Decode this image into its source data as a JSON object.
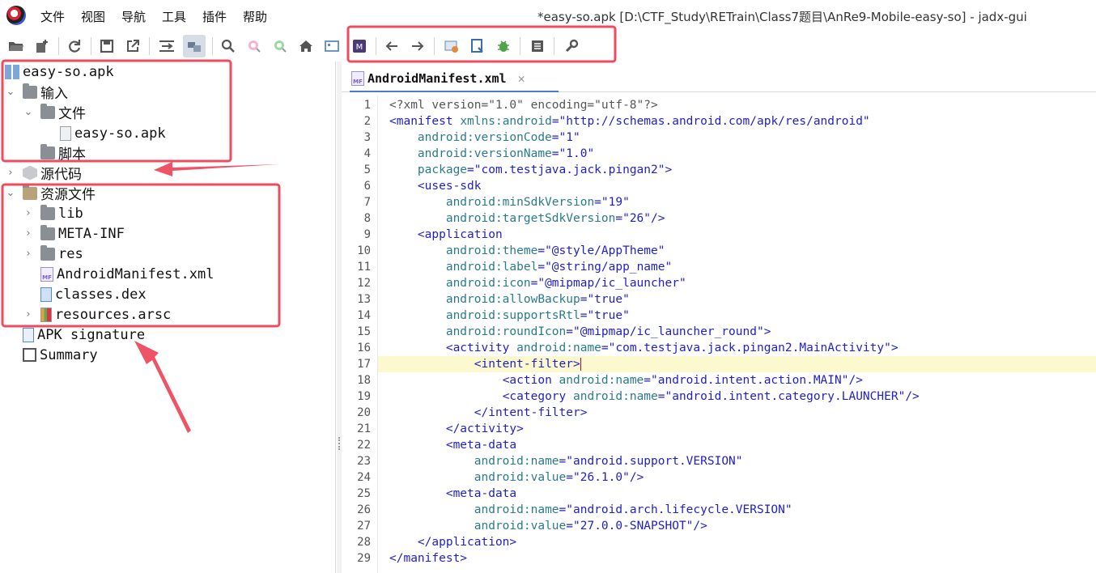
{
  "window": {
    "title": "*easy-so.apk [D:\\CTF_Study\\RETrain\\Class7题目\\AnRe9-Mobile-easy-so] - jadx-gui"
  },
  "menu": {
    "items": [
      "文件",
      "视图",
      "导航",
      "工具",
      "插件",
      "帮助"
    ]
  },
  "toolbar": {
    "buttons": [
      "open-folder-icon",
      "add-files-icon",
      "reload-icon",
      "save-icon",
      "export-icon",
      "sync-tree-icon",
      "flatten-packages-icon",
      "search-icon",
      "find-usage-icon",
      "text-search-icon",
      "home-icon",
      "preview-tab-icon",
      "smali-icon",
      "back-icon",
      "forward-icon",
      "deobfuscation-icon",
      "decompile-all-icon",
      "debugger-icon",
      "log-viewer-icon",
      "preferences-icon"
    ],
    "highlight_color": "#ee4b5e"
  },
  "tree": {
    "root": "easy-so.apk",
    "input": "输入",
    "files": "文件",
    "file_item": "easy-so.apk",
    "scripts": "脚本",
    "source_code": "源代码",
    "resources": "资源文件",
    "res_items": [
      "lib",
      "META-INF",
      "res",
      "AndroidManifest.xml",
      "classes.dex",
      "resources.arsc"
    ],
    "apk_signature": "APK signature",
    "summary": "Summary"
  },
  "editor": {
    "tab_label": "AndroidManifest.xml",
    "tab_close": "✕",
    "current_line": 17,
    "lines": [
      [
        [
          "decl",
          "<?xml version=\"1.0\" encoding=\"utf-8\"?>"
        ]
      ],
      [
        [
          "tag",
          "<manifest "
        ],
        [
          "attr",
          "xmlns:android"
        ],
        [
          "tag",
          "="
        ],
        [
          "val",
          "\"http://schemas.android.com/apk/res/android\""
        ]
      ],
      [
        [
          "sp",
          "    "
        ],
        [
          "attr",
          "android:versionCode"
        ],
        [
          "tag",
          "="
        ],
        [
          "val",
          "\"1\""
        ]
      ],
      [
        [
          "sp",
          "    "
        ],
        [
          "attr",
          "android:versionName"
        ],
        [
          "tag",
          "="
        ],
        [
          "val",
          "\"1.0\""
        ]
      ],
      [
        [
          "sp",
          "    "
        ],
        [
          "attr",
          "package"
        ],
        [
          "tag",
          "="
        ],
        [
          "val",
          "\"com.testjava.jack.pingan2\""
        ],
        [
          "tag",
          ">"
        ]
      ],
      [
        [
          "sp",
          "    "
        ],
        [
          "tag",
          "<uses-sdk"
        ]
      ],
      [
        [
          "sp",
          "        "
        ],
        [
          "attr",
          "android:minSdkVersion"
        ],
        [
          "tag",
          "="
        ],
        [
          "val",
          "\"19\""
        ]
      ],
      [
        [
          "sp",
          "        "
        ],
        [
          "attr",
          "android:targetSdkVersion"
        ],
        [
          "tag",
          "="
        ],
        [
          "val",
          "\"26\""
        ],
        [
          "tag",
          "/>"
        ]
      ],
      [
        [
          "sp",
          "    "
        ],
        [
          "tag",
          "<application"
        ]
      ],
      [
        [
          "sp",
          "        "
        ],
        [
          "attr",
          "android:theme"
        ],
        [
          "tag",
          "="
        ],
        [
          "val",
          "\"@style/AppTheme\""
        ]
      ],
      [
        [
          "sp",
          "        "
        ],
        [
          "attr",
          "android:label"
        ],
        [
          "tag",
          "="
        ],
        [
          "val",
          "\"@string/app_name\""
        ]
      ],
      [
        [
          "sp",
          "        "
        ],
        [
          "attr",
          "android:icon"
        ],
        [
          "tag",
          "="
        ],
        [
          "val",
          "\"@mipmap/ic_launcher\""
        ]
      ],
      [
        [
          "sp",
          "        "
        ],
        [
          "attr",
          "android:allowBackup"
        ],
        [
          "tag",
          "="
        ],
        [
          "val",
          "\"true\""
        ]
      ],
      [
        [
          "sp",
          "        "
        ],
        [
          "attr",
          "android:supportsRtl"
        ],
        [
          "tag",
          "="
        ],
        [
          "val",
          "\"true\""
        ]
      ],
      [
        [
          "sp",
          "        "
        ],
        [
          "attr",
          "android:roundIcon"
        ],
        [
          "tag",
          "="
        ],
        [
          "val",
          "\"@mipmap/ic_launcher_round\""
        ],
        [
          "tag",
          ">"
        ]
      ],
      [
        [
          "sp",
          "        "
        ],
        [
          "tag",
          "<activity "
        ],
        [
          "attr",
          "android:name"
        ],
        [
          "tag",
          "="
        ],
        [
          "val",
          "\"com.testjava.jack.pingan2.MainActivity\""
        ],
        [
          "tag",
          ">"
        ]
      ],
      [
        [
          "sp",
          "            "
        ],
        [
          "tag",
          "<intent-filter>"
        ]
      ],
      [
        [
          "sp",
          "                "
        ],
        [
          "tag",
          "<action "
        ],
        [
          "attr",
          "android:name"
        ],
        [
          "tag",
          "="
        ],
        [
          "val",
          "\"android.intent.action.MAIN\""
        ],
        [
          "tag",
          "/>"
        ]
      ],
      [
        [
          "sp",
          "                "
        ],
        [
          "tag",
          "<category "
        ],
        [
          "attr",
          "android:name"
        ],
        [
          "tag",
          "="
        ],
        [
          "val",
          "\"android.intent.category.LAUNCHER\""
        ],
        [
          "tag",
          "/>"
        ]
      ],
      [
        [
          "sp",
          "            "
        ],
        [
          "tag",
          "</intent-filter>"
        ]
      ],
      [
        [
          "sp",
          "        "
        ],
        [
          "tag",
          "</activity>"
        ]
      ],
      [
        [
          "sp",
          "        "
        ],
        [
          "tag",
          "<meta-data"
        ]
      ],
      [
        [
          "sp",
          "            "
        ],
        [
          "attr",
          "android:name"
        ],
        [
          "tag",
          "="
        ],
        [
          "val",
          "\"android.support.VERSION\""
        ]
      ],
      [
        [
          "sp",
          "            "
        ],
        [
          "attr",
          "android:value"
        ],
        [
          "tag",
          "="
        ],
        [
          "val",
          "\"26.1.0\""
        ],
        [
          "tag",
          "/>"
        ]
      ],
      [
        [
          "sp",
          "        "
        ],
        [
          "tag",
          "<meta-data"
        ]
      ],
      [
        [
          "sp",
          "            "
        ],
        [
          "attr",
          "android:name"
        ],
        [
          "tag",
          "="
        ],
        [
          "val",
          "\"android.arch.lifecycle.VERSION\""
        ]
      ],
      [
        [
          "sp",
          "            "
        ],
        [
          "attr",
          "android:value"
        ],
        [
          "tag",
          "="
        ],
        [
          "val",
          "\"27.0.0-SNAPSHOT\""
        ],
        [
          "tag",
          "/>"
        ]
      ],
      [
        [
          "sp",
          "    "
        ],
        [
          "tag",
          "</application>"
        ]
      ],
      [
        [
          "tag",
          "</manifest>"
        ]
      ]
    ]
  }
}
